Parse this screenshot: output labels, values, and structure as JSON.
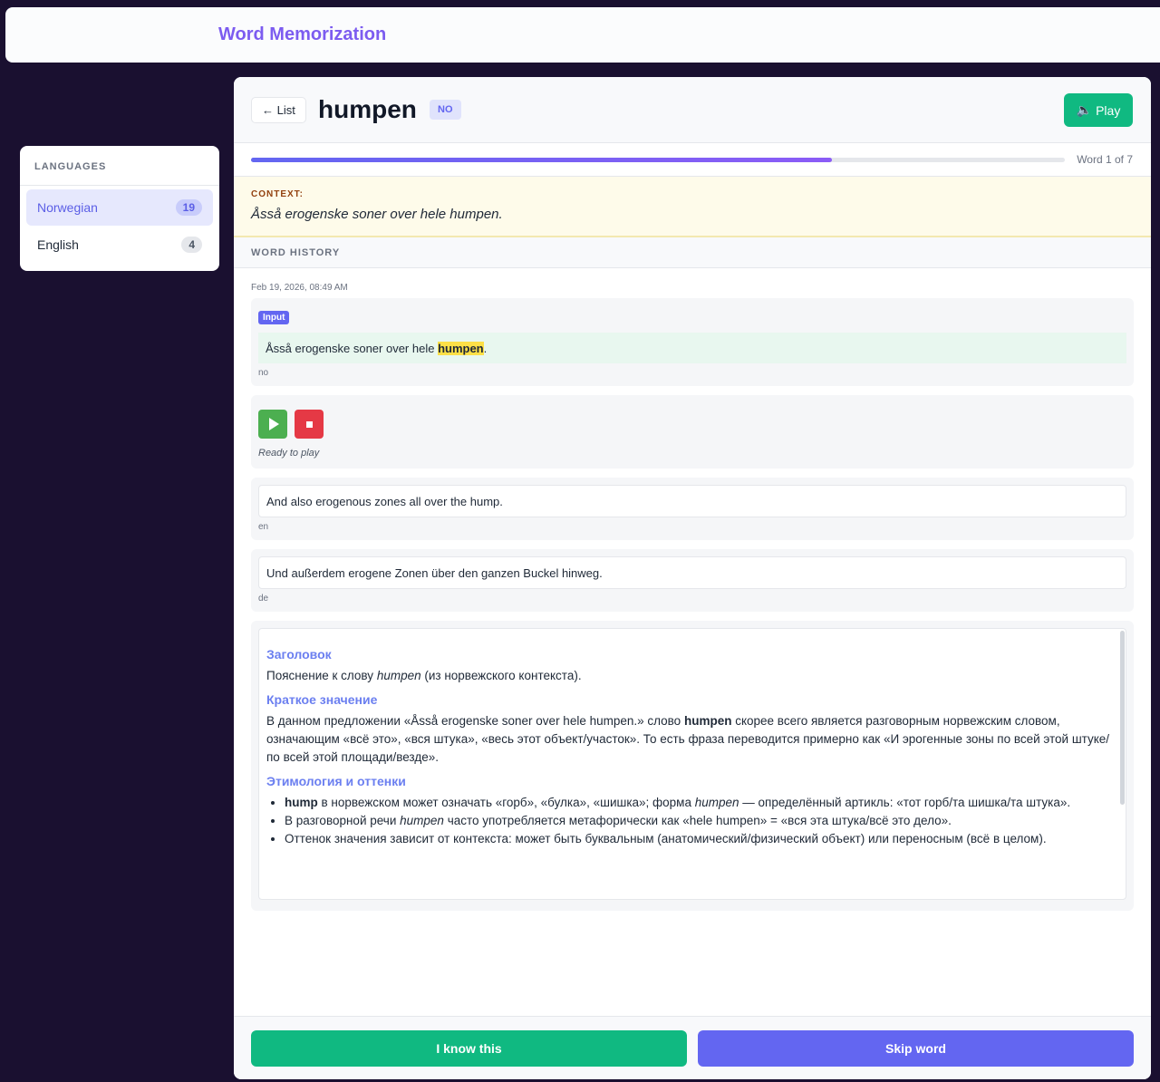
{
  "app": {
    "title": "Word Memorization"
  },
  "sidebar": {
    "heading": "LANGUAGES",
    "items": [
      {
        "label": "Norwegian",
        "count": "19",
        "active": true
      },
      {
        "label": "English",
        "count": "4"
      }
    ]
  },
  "word": {
    "back_label": "← List",
    "text": "humpen",
    "lang_badge": "NO",
    "play_label": "Play",
    "progress_percent": 71.4,
    "counter": "Word 1 of 7"
  },
  "context": {
    "label": "CONTEXT:",
    "text": "Åsså erogenske soner over hele humpen."
  },
  "history": {
    "heading": "WORD HISTORY",
    "date": "Feb 19, 2026, 08:49 AM",
    "input": {
      "tag": "Input",
      "before": "Åsså erogenske soner over hele ",
      "highlight": "humpen",
      "after": ".",
      "lang": "no"
    },
    "audio": {
      "status": "Ready to play"
    },
    "translations": [
      {
        "text": "And also erogenous zones all over the hump.",
        "lang": "en"
      },
      {
        "text": "Und außerdem erogene Zonen über den ganzen Buckel hinweg.",
        "lang": "de"
      }
    ],
    "explanation": {
      "h1": "Заголовок",
      "p1a": "Пояснение к слову ",
      "p1i": "humpen",
      "p1b": " (из норвежского контекста).",
      "h2": "Краткое значение",
      "p2a": "В данном предложении «Åsså erogenske soner over hele humpen.» слово ",
      "p2b": "humpen",
      "p2c": " скорее всего является разговорным норвежским словом, означающим «всё это», «вся штука», «весь этот объект/участок». То есть фраза переводится примерно как «И эрогенные зоны по всей этой штуке/по всей этой площади/везде».",
      "h3": "Этимология и оттенки",
      "b1a": "hump",
      "b1b": " в норвежском может означать «горб», «булка», «шишка»; форма ",
      "b1c": "humpen",
      "b1d": " — определённый артикль: «тот горб/та шишка/та штука».",
      "b2a": "В разговорной речи ",
      "b2b": "humpen",
      "b2c": " часто употребляется метафорически как «hele humpen» = «вся эта штука/всё это дело».",
      "b3": "Оттенок значения зависит от контекста: может быть буквальным (анатомический/физический объект) или переносным (всё в целом)."
    }
  },
  "footer": {
    "know_label": "I know this",
    "skip_label": "Skip word"
  }
}
